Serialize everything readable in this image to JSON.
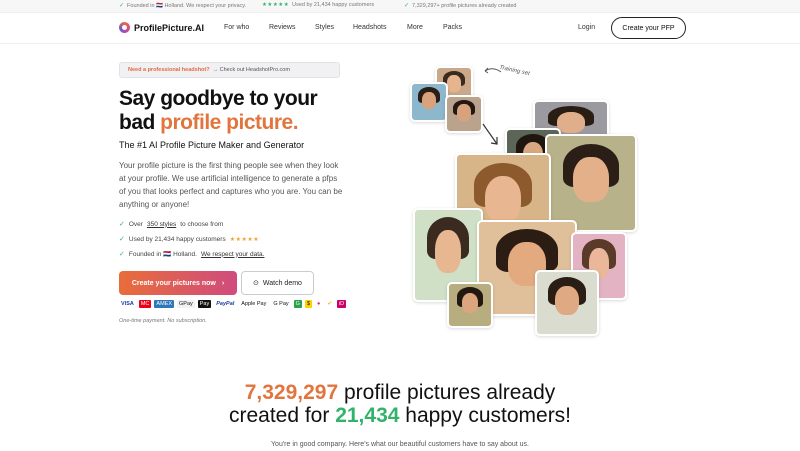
{
  "topbar": {
    "item1": "Founded in 🇳🇱 Holland. We respect your privacy.",
    "stars": "★★★★★",
    "item2": "Used by 21,434 happy customers",
    "item3": "7,329,297+ profile pictures already created",
    "accent_color": "#33b26b"
  },
  "nav": {
    "logo": "ProfilePicture.AI",
    "links": [
      "For who",
      "Reviews",
      "Styles",
      "Headshots",
      "More",
      "Packs"
    ],
    "login": "Login",
    "cta": "Create your PFP"
  },
  "banner": {
    "strong": "Need a professional headshot?",
    "rest": "→ Check out HeadshotPro.com"
  },
  "hero": {
    "title_line1": "Say goodbye to your",
    "title_line2_prefix": "bad ",
    "title_accent": "profile picture.",
    "subtitle": "The #1 AI Profile Picture Maker and Generator",
    "description": "Your profile picture is the first thing people see when they look at your profile. We use artificial intelligence to generate a pfps of you that looks perfect and captures who you are. You can be anything or anyone!",
    "features": [
      {
        "prefix": "Over ",
        "link": "350 styles ",
        "suffix": "to choose from"
      },
      {
        "prefix": "Used by 21,434 happy customers",
        "stars": "★★★★★"
      },
      {
        "prefix": "Founded in 🇳🇱 Holland. ",
        "link": "We respect your data."
      }
    ],
    "cta_primary": "Create your pictures now",
    "cta_secondary": "Watch demo",
    "payment_methods": [
      "VISA",
      "MC",
      "AMEX",
      "GPay",
      "Pay",
      "PayPal",
      "Apple Pay",
      "G Pay",
      "G",
      "$",
      "●",
      "✔",
      "iD"
    ],
    "note": "One-time payment. No subscription.",
    "training_label": "Training set",
    "accent_color": "#e2753e"
  },
  "stats": {
    "pictures_count": "7,329,297",
    "pictures_text": " profile pictures already",
    "created_for": "created for ",
    "customers_count": "21,434",
    "customers_text": " happy customers!",
    "subline": "You're in good company. Here's what our beautiful customers have to say about us."
  }
}
